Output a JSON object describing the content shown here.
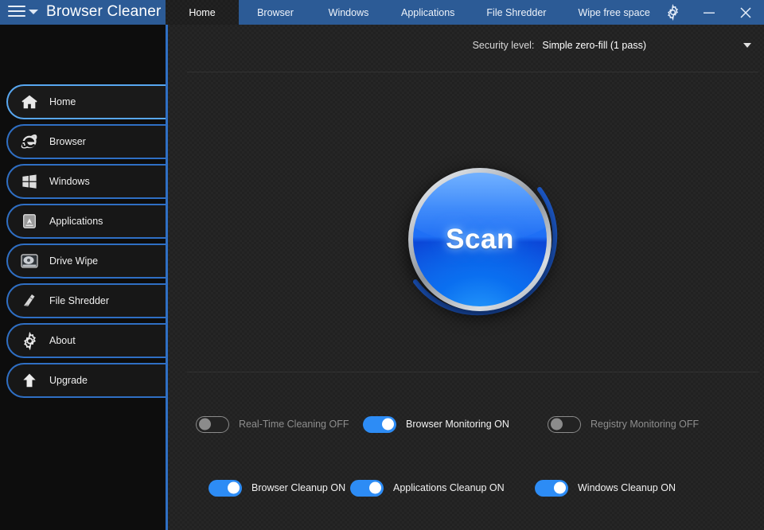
{
  "window": {
    "title": "Browser Cleaner",
    "menu_icon": "hamburger-icon",
    "menu_caret_icon": "chevron-down-icon",
    "minimize_label": "Minimize",
    "close_label": "Close",
    "settings_label": "Settings"
  },
  "tabs": [
    {
      "label": "Home",
      "active": true
    },
    {
      "label": "Browser",
      "active": false
    },
    {
      "label": "Windows",
      "active": false
    },
    {
      "label": "Applications",
      "active": false
    },
    {
      "label": "File Shredder",
      "active": false
    },
    {
      "label": "Wipe free space",
      "active": false
    }
  ],
  "sidebar": {
    "items": [
      {
        "label": "Home",
        "icon": "home-icon",
        "active": true
      },
      {
        "label": "Browser",
        "icon": "internet-explorer-icon",
        "active": false
      },
      {
        "label": "Windows",
        "icon": "windows-logo-icon",
        "active": false
      },
      {
        "label": "Applications",
        "icon": "applications-icon",
        "active": false
      },
      {
        "label": "Drive Wipe",
        "icon": "hard-drive-icon",
        "active": false
      },
      {
        "label": "File Shredder",
        "icon": "shredder-icon",
        "active": false
      },
      {
        "label": "About",
        "icon": "gear-icon",
        "active": false
      },
      {
        "label": "Upgrade",
        "icon": "up-arrow-icon",
        "active": false
      }
    ]
  },
  "security": {
    "label": "Security level:",
    "value": "Simple zero-fill (1 pass)",
    "caret_icon": "chevron-down-icon"
  },
  "scan": {
    "label": "Scan"
  },
  "toggles": {
    "row1": [
      {
        "label": "Real-Time Cleaning OFF",
        "state": "off"
      },
      {
        "label": "Browser Monitoring ON",
        "state": "on"
      },
      {
        "label": "Registry Monitoring OFF",
        "state": "off"
      }
    ],
    "row2": [
      {
        "label": "Browser Cleanup ON",
        "state": "on"
      },
      {
        "label": "Applications Cleanup ON",
        "state": "on"
      },
      {
        "label": "Windows Cleanup ON",
        "state": "on"
      }
    ]
  },
  "colors": {
    "titlebar_blue": "#2c5b96",
    "accent_blue": "#2f6fc4",
    "active_nav_blue": "#58a7f0",
    "toggle_on": "#2d8cf5",
    "toggle_off": "#8b8b8b",
    "panel_dark": "#212121",
    "sidebar_dark": "#0d0d0d"
  }
}
